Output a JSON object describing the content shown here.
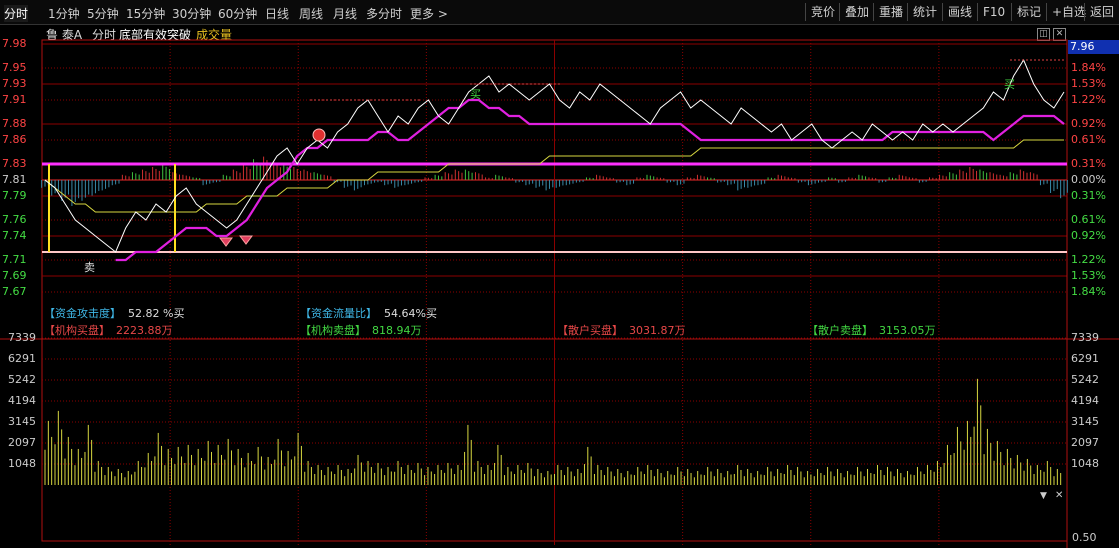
{
  "tabs": [
    {
      "label": "分时",
      "active": true
    },
    {
      "label": "1分钟"
    },
    {
      "label": "5分钟"
    },
    {
      "label": "15分钟"
    },
    {
      "label": "30分钟"
    },
    {
      "label": "60分钟"
    },
    {
      "label": "日线"
    },
    {
      "label": "周线"
    },
    {
      "label": "月线"
    },
    {
      "label": "多分时"
    },
    {
      "label": "更多"
    }
  ],
  "right_buttons": [
    "竞价",
    "叠加",
    "重播",
    "统计",
    "画线",
    "F10",
    "标记",
    "+自选",
    "返回"
  ],
  "header": {
    "stock": "鲁 泰A",
    "mode": "分时",
    "indicator": "底部有效突破",
    "volume_label": "成交量"
  },
  "current_price": "7.96",
  "price_axis": [
    "7.98",
    "7.95",
    "7.93",
    "7.91",
    "7.88",
    "7.86",
    "7.83",
    "7.81",
    "7.79",
    "7.76",
    "7.74",
    "7.71",
    "7.69",
    "7.67"
  ],
  "pct_axis": [
    "1.84%",
    "1.53%",
    "1.22%",
    "0.92%",
    "0.61%",
    "0.31%",
    "0.00%",
    "0.31%",
    "0.61%",
    "0.92%",
    "1.22%",
    "1.53%",
    "1.84%"
  ],
  "vol_axis": [
    "7339",
    "6291",
    "5242",
    "4194",
    "3145",
    "2097",
    "1048"
  ],
  "bottom_label": "0.50",
  "info": {
    "attack_label": "【资金攻击度】",
    "attack_value": "52.82 %买",
    "flow_label": "【资金流量比】",
    "flow_value": "54.64%买",
    "inst_buy_label": "【机构买盘】",
    "inst_buy_value": "2223.88万",
    "inst_sell_label": "【机构卖盘】",
    "inst_sell_value": "818.94万",
    "retail_buy_label": "【散户买盘】",
    "retail_buy_value": "3031.87万",
    "retail_sell_label": "【散户卖盘】",
    "retail_sell_value": "3153.05万"
  },
  "markers": {
    "buy": "买",
    "sell": "卖"
  },
  "icons": {
    "window_restore": "window-restore-icon",
    "window_close": "close-icon",
    "scroll_down": "chevron-down-icon"
  },
  "colors": {
    "price_line": "#ffffff",
    "avg_line": "#d8d840",
    "indicator_line": "#e020e0",
    "grid": "#8b0000",
    "axis_red": "#ff4444",
    "axis_green": "#44dd44",
    "magenta_band": "#ff30ff",
    "volume_bar": "#d8d840"
  },
  "chart_data": {
    "type": "line",
    "price_range": [
      7.66,
      7.98
    ],
    "prev_close": 7.81,
    "band_upper": 7.83,
    "band_lower": 7.72,
    "price": [
      7.81,
      7.8,
      7.78,
      7.76,
      7.75,
      7.74,
      7.73,
      7.72,
      7.75,
      7.77,
      7.76,
      7.78,
      7.77,
      7.79,
      7.8,
      7.78,
      7.77,
      7.76,
      7.75,
      7.76,
      7.78,
      7.8,
      7.82,
      7.84,
      7.85,
      7.83,
      7.85,
      7.86,
      7.85,
      7.87,
      7.88,
      7.9,
      7.91,
      7.89,
      7.87,
      7.89,
      7.88,
      7.9,
      7.91,
      7.89,
      7.88,
      7.9,
      7.92,
      7.93,
      7.94,
      7.92,
      7.93,
      7.92,
      7.91,
      7.92,
      7.93,
      7.91,
      7.9,
      7.92,
      7.91,
      7.93,
      7.92,
      7.91,
      7.9,
      7.89,
      7.88,
      7.9,
      7.91,
      7.92,
      7.9,
      7.91,
      7.9,
      7.89,
      7.88,
      7.9,
      7.89,
      7.88,
      7.87,
      7.88,
      7.86,
      7.87,
      7.88,
      7.86,
      7.85,
      7.86,
      7.87,
      7.86,
      7.88,
      7.87,
      7.86,
      7.87,
      7.86,
      7.88,
      7.87,
      7.88,
      7.87,
      7.88,
      7.89,
      7.9,
      7.92,
      7.91,
      7.94,
      7.96,
      7.93,
      7.91,
      7.9,
      7.92
    ],
    "avg_price": [
      7.81,
      7.8,
      7.79,
      7.78,
      7.78,
      7.77,
      7.77,
      7.77,
      7.77,
      7.77,
      7.77,
      7.77,
      7.77,
      7.77,
      7.77,
      7.77,
      7.78,
      7.78,
      7.78,
      7.78,
      7.79,
      7.79,
      7.79,
      7.79,
      7.8,
      7.8,
      7.8,
      7.8,
      7.8,
      7.81,
      7.81,
      7.81,
      7.81,
      7.82,
      7.82,
      7.82,
      7.82,
      7.82,
      7.82,
      7.82,
      7.83,
      7.83,
      7.83,
      7.83,
      7.83,
      7.83,
      7.83,
      7.83,
      7.83,
      7.83,
      7.84,
      7.84,
      7.84,
      7.84,
      7.84,
      7.84,
      7.84,
      7.84,
      7.84,
      7.84,
      7.84,
      7.84,
      7.84,
      7.84,
      7.84,
      7.85,
      7.85,
      7.85,
      7.85,
      7.85,
      7.85,
      7.85,
      7.85,
      7.85,
      7.85,
      7.85,
      7.85,
      7.85,
      7.85,
      7.85,
      7.85,
      7.85,
      7.85,
      7.85,
      7.85,
      7.85,
      7.85,
      7.85,
      7.85,
      7.85,
      7.85,
      7.85,
      7.85,
      7.85,
      7.85,
      7.85,
      7.85,
      7.86,
      7.86,
      7.86,
      7.86,
      7.86
    ],
    "indicator": [
      null,
      null,
      null,
      null,
      null,
      null,
      null,
      7.71,
      7.71,
      7.72,
      7.72,
      7.72,
      7.73,
      7.74,
      7.75,
      7.75,
      7.75,
      7.74,
      7.74,
      7.75,
      7.76,
      7.78,
      7.8,
      7.81,
      7.82,
      7.84,
      7.85,
      7.85,
      7.86,
      7.86,
      7.86,
      7.86,
      7.86,
      7.87,
      7.87,
      7.86,
      7.86,
      7.87,
      7.88,
      7.89,
      7.9,
      7.9,
      7.91,
      7.91,
      7.9,
      7.9,
      7.89,
      7.89,
      7.88,
      7.88,
      7.88,
      7.88,
      7.88,
      7.88,
      7.88,
      7.88,
      7.88,
      7.88,
      7.88,
      7.88,
      7.88,
      7.88,
      7.88,
      7.88,
      7.87,
      7.86,
      7.86,
      7.86,
      7.86,
      7.86,
      7.86,
      7.86,
      7.86,
      7.86,
      7.86,
      7.86,
      7.86,
      7.86,
      7.86,
      7.86,
      7.86,
      7.86,
      7.86,
      7.86,
      7.87,
      7.87,
      7.87,
      7.87,
      7.87,
      7.87,
      7.87,
      7.87,
      7.87,
      7.87,
      7.86,
      7.87,
      7.88,
      7.89,
      7.89,
      7.89,
      7.89,
      7.88
    ],
    "flow": [
      -3,
      -6,
      -8,
      -10,
      -8,
      -6,
      -4,
      -2,
      2,
      3,
      4,
      5,
      6,
      3,
      2,
      1,
      -2,
      -1,
      2,
      4,
      6,
      8,
      9,
      7,
      6,
      5,
      4,
      3,
      2,
      -1,
      -3,
      -4,
      -2,
      -1,
      -2,
      -3,
      -2,
      -1,
      1,
      2,
      3,
      4,
      4,
      3,
      1,
      2,
      1,
      -1,
      -2,
      -3,
      -4,
      -3,
      -2,
      -1,
      1,
      2,
      1,
      -1,
      -2,
      1,
      2,
      1,
      -1,
      -2,
      1,
      2,
      1,
      -1,
      -2,
      -4,
      -3,
      -2,
      1,
      2,
      1,
      -1,
      -2,
      -1,
      1,
      -1,
      1,
      2,
      1,
      -1,
      1,
      2,
      1,
      -1,
      1,
      2,
      3,
      4,
      5,
      4,
      3,
      2,
      3,
      4,
      3,
      -2,
      -5,
      -7
    ],
    "volume": [
      3200,
      3700,
      2400,
      1800,
      3000,
      1200,
      900,
      800,
      700,
      1200,
      1600,
      2600,
      1800,
      1900,
      2000,
      1800,
      2200,
      2000,
      2300,
      1800,
      1600,
      1900,
      1400,
      2300,
      1700,
      2600,
      1200,
      1000,
      900,
      1000,
      800,
      1500,
      1200,
      1100,
      900,
      1200,
      1000,
      1100,
      900,
      1000,
      1100,
      1000,
      3000,
      1200,
      1000,
      2000,
      900,
      1000,
      1100,
      800,
      700,
      1000,
      900,
      800,
      1900,
      1000,
      900,
      800,
      700,
      900,
      1000,
      800,
      700,
      900,
      800,
      700,
      900,
      800,
      700,
      1000,
      800,
      700,
      900,
      800,
      1000,
      900,
      700,
      800,
      900,
      800,
      700,
      900,
      800,
      1000,
      900,
      800,
      700,
      900,
      1000,
      1200,
      2000,
      2900,
      3200,
      5300,
      2800,
      2200,
      1800,
      1500,
      1300,
      1000,
      1200,
      800
    ],
    "volume_range": [
      0,
      7339
    ],
    "grid": true
  }
}
